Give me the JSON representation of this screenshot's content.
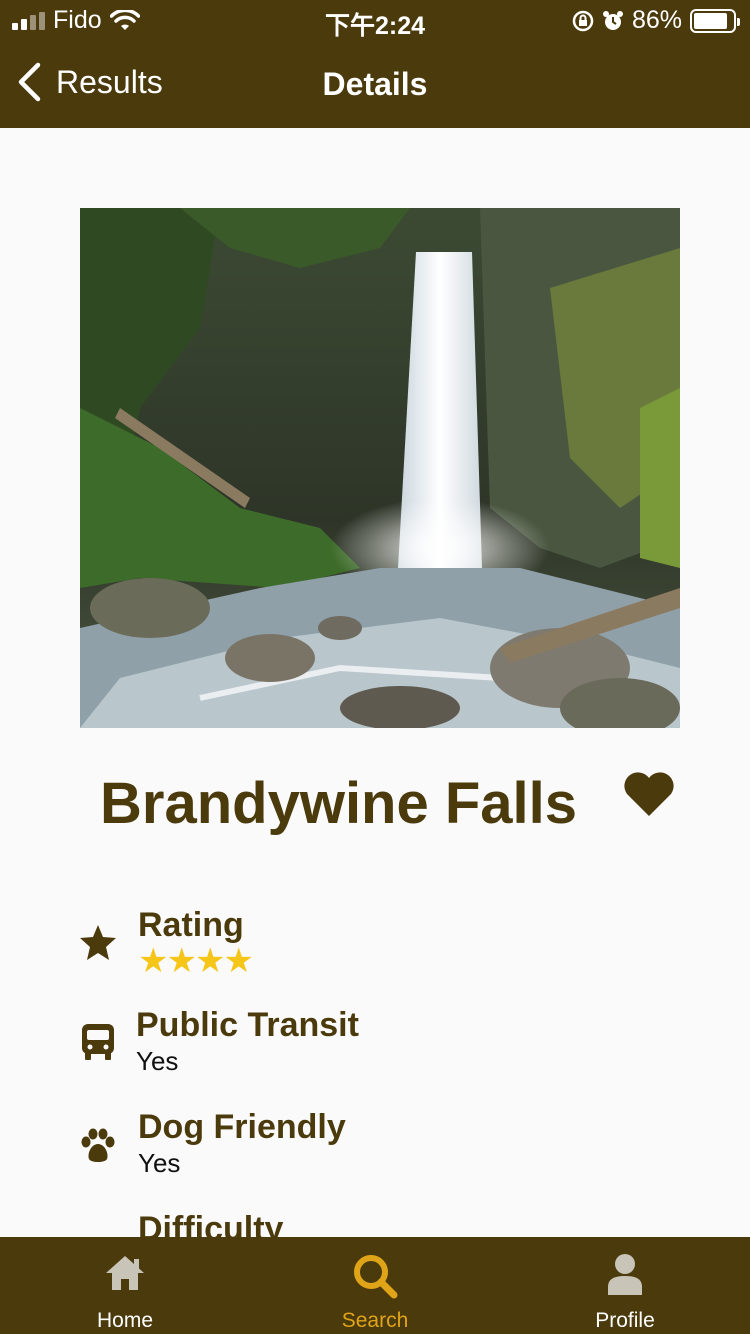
{
  "status_bar": {
    "carrier": "Fido",
    "time": "下午2:24",
    "battery": "86%"
  },
  "nav": {
    "back_label": "Results",
    "title": "Details"
  },
  "place": {
    "name": "Brandywine Falls",
    "favorite": true
  },
  "details": {
    "rating_label": "Rating",
    "rating_stars": "★★★★",
    "rating_value": 4,
    "transit_label": "Public Transit",
    "transit_value": "Yes",
    "dog_label": "Dog Friendly",
    "dog_value": "Yes",
    "difficulty_label": "Difficulty"
  },
  "tabs": [
    {
      "label": "Home",
      "icon": "home-icon"
    },
    {
      "label": "Search",
      "icon": "search-icon",
      "active": true
    },
    {
      "label": "Profile",
      "icon": "profile-icon"
    }
  ],
  "colors": {
    "brand": "#4b3a0c",
    "accent": "#e0a418",
    "star": "#f5c518"
  }
}
